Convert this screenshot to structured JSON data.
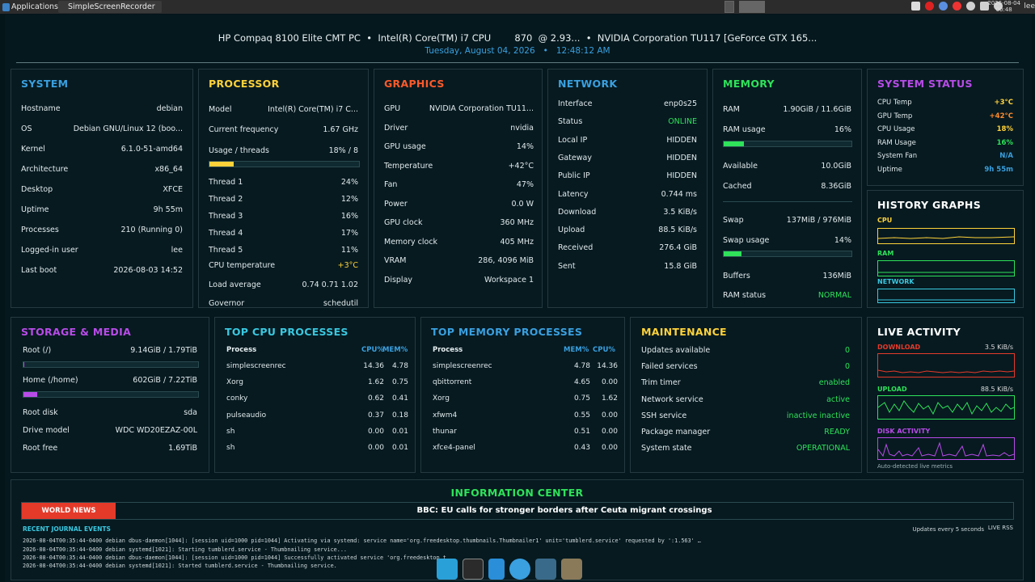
{
  "topbar": {
    "apps_label": "Applications",
    "task_label": "SimpleScreenRecorder",
    "clock_date": "2026-08-04",
    "clock_time": "00:48",
    "user": "lee"
  },
  "header": {
    "line1": "HP Compaq 8100 Elite CMT PC  •  Intel(R) Core(TM) i7 CPU        870  @ 2.93...  •  NVIDIA Corporation TU117 [GeForce GTX 165...",
    "line2": "Tuesday, August 04, 2026   •   12:48:12 AM"
  },
  "colors": {
    "system": "#3aa0e0",
    "processor": "#ffd23a",
    "graphics": "#ff5a2a",
    "network": "#3aa0e0",
    "memory": "#2fe25a",
    "status": "#b84ce8",
    "green": "#2fe25a",
    "red": "#e43a2a"
  },
  "system": {
    "title": "SYSTEM",
    "rows": [
      {
        "k": "Hostname",
        "v": "debian"
      },
      {
        "k": "OS",
        "v": "Debian GNU/Linux 12 (boo..."
      },
      {
        "k": "Kernel",
        "v": "6.1.0-51-amd64"
      },
      {
        "k": "Architecture",
        "v": "x86_64"
      },
      {
        "k": "Desktop",
        "v": "XFCE"
      },
      {
        "k": "Uptime",
        "v": "9h 55m"
      },
      {
        "k": "Processes",
        "v": "210 (Running 0)"
      },
      {
        "k": "Logged-in user",
        "v": "lee"
      },
      {
        "k": "Last boot",
        "v": "2026-08-03 14:52"
      }
    ]
  },
  "processor": {
    "title": "PROCESSOR",
    "model_k": "Model",
    "model_v": "Intel(R) Core(TM) i7 C...",
    "freq_k": "Current frequency",
    "freq_v": "1.67 GHz",
    "usage_k": "Usage / threads",
    "usage_v": "18% / 8",
    "usage_fraction": 0.18,
    "threads": [
      {
        "k": "Thread 1",
        "v": "24%"
      },
      {
        "k": "Thread 2",
        "v": "12%"
      },
      {
        "k": "Thread 3",
        "v": "16%"
      },
      {
        "k": "Thread 4",
        "v": "17%"
      },
      {
        "k": "Thread 5",
        "v": "11%"
      }
    ],
    "temp_k": "CPU temperature",
    "temp_v": "+3°C",
    "load_k": "Load average",
    "load_v": "0.74 0.71 1.02",
    "gov_k": "Governor",
    "gov_v": "schedutil"
  },
  "graphics": {
    "title": "GRAPHICS",
    "rows": [
      {
        "k": "GPU",
        "v": "NVIDIA Corporation TU11..."
      },
      {
        "k": "Driver",
        "v": "nvidia"
      },
      {
        "k": "GPU usage",
        "v": "14%"
      },
      {
        "k": "Temperature",
        "v": "+42°C"
      },
      {
        "k": "Fan",
        "v": "47%"
      },
      {
        "k": "Power",
        "v": "0.0 W"
      },
      {
        "k": "GPU clock",
        "v": "360 MHz"
      },
      {
        "k": "Memory clock",
        "v": "405 MHz"
      },
      {
        "k": "VRAM",
        "v": "286, 4096 MiB"
      },
      {
        "k": "Display",
        "v": "Workspace 1"
      }
    ]
  },
  "network": {
    "title": "NETWORK",
    "rows": [
      {
        "k": "Interface",
        "v": "enp0s25"
      },
      {
        "k": "Status",
        "v": "ONLINE"
      },
      {
        "k": "Local IP",
        "v": "HIDDEN"
      },
      {
        "k": "Gateway",
        "v": "HIDDEN"
      },
      {
        "k": "Public IP",
        "v": "HIDDEN"
      },
      {
        "k": "Latency",
        "v": "0.744 ms"
      },
      {
        "k": "Download",
        "v": "3.5 KiB/s"
      },
      {
        "k": "Upload",
        "v": "88.5 KiB/s"
      },
      {
        "k": "Received",
        "v": "276.4 GiB"
      },
      {
        "k": "Sent",
        "v": "15.8 GiB"
      }
    ]
  },
  "memory": {
    "title": "MEMORY",
    "ram_k": "RAM",
    "ram_v": "1.90GiB / 11.6GiB",
    "ramuse_k": "RAM usage",
    "ramuse_v": "16%",
    "ramuse_fraction": 0.16,
    "avail_k": "Available",
    "avail_v": "10.0GiB",
    "cached_k": "Cached",
    "cached_v": "8.36GiB",
    "swap_k": "Swap",
    "swap_v": "137MiB / 976MiB",
    "swapuse_k": "Swap usage",
    "swapuse_v": "14%",
    "swapuse_fraction": 0.14,
    "buffers_k": "Buffers",
    "buffers_v": "136MiB",
    "ramstatus_k": "RAM status",
    "ramstatus_v": "NORMAL"
  },
  "sysstatus": {
    "title": "SYSTEM STATUS",
    "rows": [
      {
        "k": "CPU Temp",
        "v": "+3°C"
      },
      {
        "k": "GPU Temp",
        "v": "+42°C"
      },
      {
        "k": "CPU Usage",
        "v": "18%"
      },
      {
        "k": "RAM Usage",
        "v": "16%"
      },
      {
        "k": "System Fan",
        "v": "N/A"
      },
      {
        "k": "Uptime",
        "v": "9h 55m"
      }
    ]
  },
  "history": {
    "title": "HISTORY GRAPHS",
    "cpu": "CPU",
    "ram": "RAM",
    "network": "NETWORK"
  },
  "storage": {
    "title": "STORAGE & MEDIA",
    "root_k": "Root (/)",
    "root_v": "9.14GiB / 1.79TiB",
    "root_fraction": 0.005,
    "home_k": "Home (/home)",
    "home_v": "602GiB / 7.22TiB",
    "home_fraction": 0.08,
    "disk_k": "Root disk",
    "disk_v": "sda",
    "model_k": "Drive model",
    "model_v": "WDC WD20EZAZ-00L",
    "free_k": "Root free",
    "free_v": "1.69TiB"
  },
  "topcpu": {
    "title": "TOP CPU PROCESSES",
    "h_proc": "Process",
    "h_cpu": "CPU%",
    "h_mem": "MEM%",
    "rows": [
      {
        "p": "simplescreenrec",
        "a": "14.36",
        "b": "4.78"
      },
      {
        "p": "Xorg",
        "a": "1.62",
        "b": "0.75"
      },
      {
        "p": "conky",
        "a": "0.62",
        "b": "0.41"
      },
      {
        "p": "pulseaudio",
        "a": "0.37",
        "b": "0.18"
      },
      {
        "p": "sh",
        "a": "0.00",
        "b": "0.01"
      },
      {
        "p": "sh",
        "a": "0.00",
        "b": "0.01"
      }
    ]
  },
  "topmem": {
    "title": "TOP MEMORY PROCESSES",
    "h_proc": "Process",
    "h_mem": "MEM%",
    "h_cpu": "CPU%",
    "rows": [
      {
        "p": "simplescreenrec",
        "a": "4.78",
        "b": "14.36"
      },
      {
        "p": "qbittorrent",
        "a": "4.65",
        "b": "0.00"
      },
      {
        "p": "Xorg",
        "a": "0.75",
        "b": "1.62"
      },
      {
        "p": "xfwm4",
        "a": "0.55",
        "b": "0.00"
      },
      {
        "p": "thunar",
        "a": "0.51",
        "b": "0.00"
      },
      {
        "p": "xfce4-panel",
        "a": "0.43",
        "b": "0.00"
      }
    ]
  },
  "maintenance": {
    "title": "MAINTENANCE",
    "rows": [
      {
        "k": "Updates available",
        "v": "0"
      },
      {
        "k": "Failed services",
        "v": "0"
      },
      {
        "k": "Trim timer",
        "v": "enabled"
      },
      {
        "k": "Network service",
        "v": "active"
      },
      {
        "k": "SSH service",
        "v": "inactive inactive"
      },
      {
        "k": "Package manager",
        "v": "READY"
      },
      {
        "k": "System state",
        "v": "OPERATIONAL"
      }
    ]
  },
  "live": {
    "title": "LIVE ACTIVITY",
    "download": "DOWNLOAD",
    "download_v": "3.5 KiB/s",
    "upload": "UPLOAD",
    "upload_v": "88.5 KiB/s",
    "disk": "DISK ACTIVITY",
    "footer": "Auto-detected live metrics"
  },
  "info": {
    "title": "INFORMATION CENTER",
    "news_label": "WORLD NEWS",
    "headline": "BBC: EU calls for stronger borders after Ceuta migrant crossings",
    "journal_label": "RECENT JOURNAL EVENTS",
    "updates_note": "Updates every 5 seconds",
    "rss": "LIVE RSS",
    "journal": [
      "2026-08-04T00:35:44-0400 debian dbus-daemon[1044]: [session uid=1000 pid=1044] Activating via systemd: service name='org.freedesktop.thumbnails.Thumbnailer1' unit='tumblerd.service' requested by ':1.563' …",
      "2026-08-04T00:35:44-0400 debian systemd[1021]: Starting tumblerd.service - Thumbnailing service...",
      "2026-08-04T00:35:44-0400 debian dbus-daemon[1044]: [session uid=1000 pid=1044] Successfully activated service 'org.freedesktop.t…",
      "2026-08-04T00:35:44-0400 debian systemd[1021]: Started tumblerd.service - Thumbnailing service."
    ]
  },
  "dock": {
    "items": [
      "desktop-icon",
      "terminal-icon",
      "file-editor-icon",
      "browser-icon",
      "search-icon",
      "folder-icon"
    ]
  }
}
